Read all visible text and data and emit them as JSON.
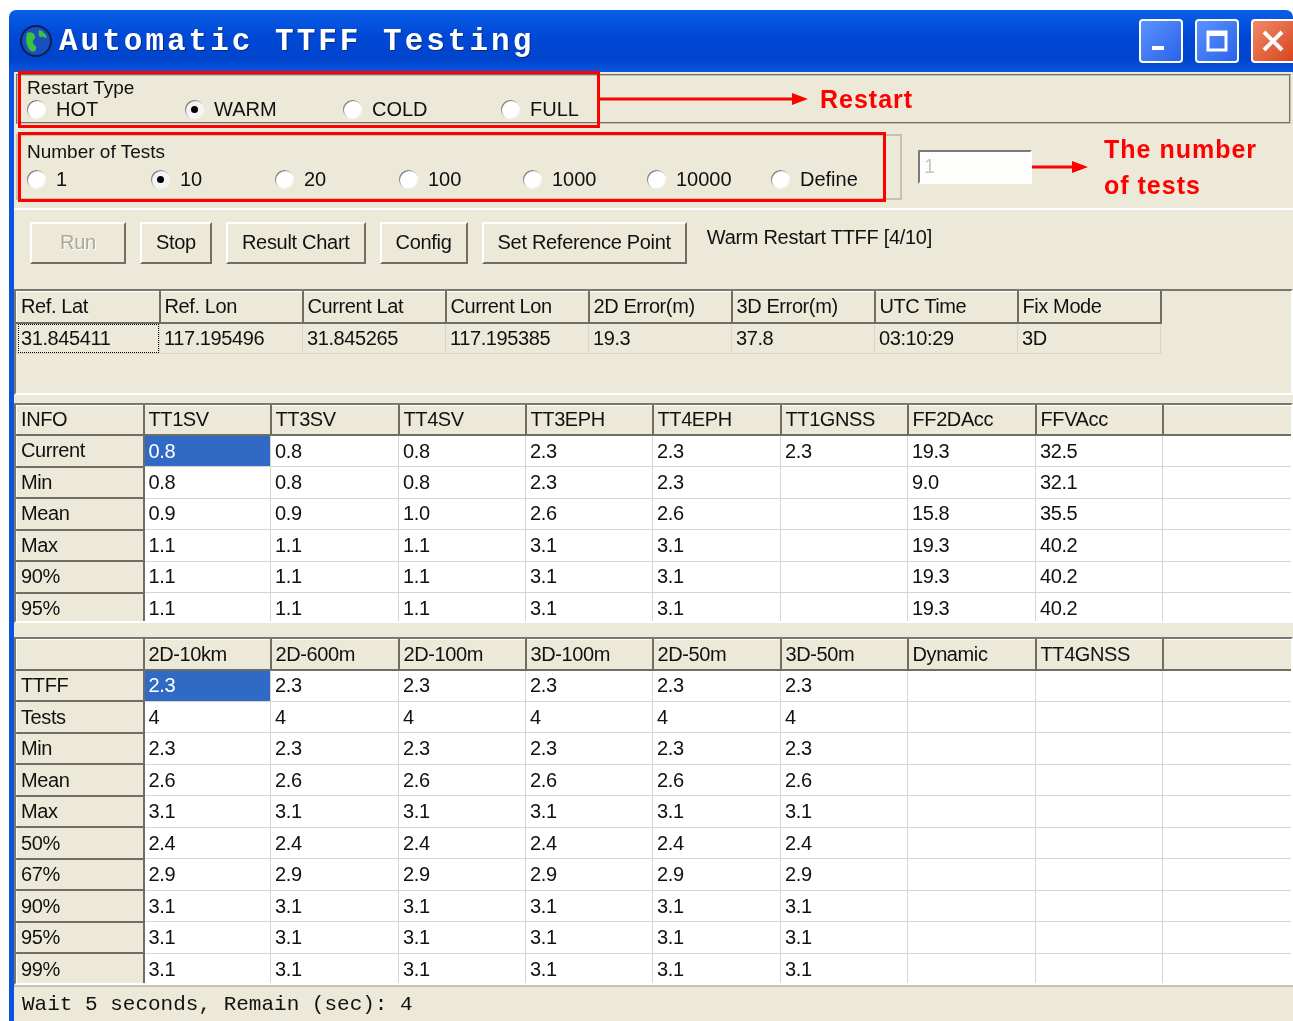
{
  "window": {
    "title": "Automatic TTFF Testing"
  },
  "restart_type": {
    "label": "Restart Type",
    "options": [
      {
        "label": "HOT",
        "selected": false
      },
      {
        "label": "WARM",
        "selected": true
      },
      {
        "label": "COLD",
        "selected": false
      },
      {
        "label": "FULL",
        "selected": false
      }
    ]
  },
  "number_of_tests": {
    "label": "Number of Tests",
    "options": [
      {
        "label": "1",
        "selected": false
      },
      {
        "label": "10",
        "selected": true
      },
      {
        "label": "20",
        "selected": false
      },
      {
        "label": "100",
        "selected": false
      },
      {
        "label": "1000",
        "selected": false
      },
      {
        "label": "10000",
        "selected": false
      },
      {
        "label": "Define",
        "selected": false
      }
    ],
    "define_field": {
      "value": "1",
      "disabled": true
    }
  },
  "annotations": [
    {
      "label": "Restart"
    },
    {
      "label": "The number of tests"
    }
  ],
  "buttons": [
    {
      "label": "Run",
      "disabled": true
    },
    {
      "label": "Stop",
      "disabled": false
    },
    {
      "label": "Result Chart",
      "disabled": false
    },
    {
      "label": "Config",
      "disabled": false
    },
    {
      "label": "Set Reference Point",
      "disabled": false
    }
  ],
  "progress_text": "Warm Restart TTFF [4/10]",
  "position_table": {
    "columns": [
      "Ref. Lat",
      "Ref. Lon",
      "Current Lat",
      "Current Lon",
      "2D Error(m)",
      "3D Error(m)",
      "UTC Time",
      "Fix Mode"
    ],
    "rows": [
      {
        "focused": true,
        "cells": [
          "31.845411",
          "117.195496",
          "31.845265",
          "117.195385",
          "19.3",
          "37.8",
          "03:10:29",
          "3D"
        ]
      }
    ]
  },
  "info_table": {
    "columns": [
      "INFO",
      "TT1SV",
      "TT3SV",
      "TT4SV",
      "TT3EPH",
      "TT4EPH",
      "TT1GNSS",
      "FF2DAcc",
      "FFVAcc"
    ],
    "rows": [
      {
        "selected": true,
        "cells": [
          "Current",
          "0.8",
          "0.8",
          "0.8",
          "2.3",
          "2.3",
          "2.3",
          "19.3",
          "32.5"
        ]
      },
      {
        "selected": false,
        "cells": [
          "Min",
          "0.8",
          "0.8",
          "0.8",
          "2.3",
          "2.3",
          "",
          "9.0",
          "32.1"
        ]
      },
      {
        "selected": false,
        "cells": [
          "Mean",
          "0.9",
          "0.9",
          "1.0",
          "2.6",
          "2.6",
          "",
          "15.8",
          "35.5"
        ]
      },
      {
        "selected": false,
        "cells": [
          "Max",
          "1.1",
          "1.1",
          "1.1",
          "3.1",
          "3.1",
          "",
          "19.3",
          "40.2"
        ]
      },
      {
        "selected": false,
        "cells": [
          "90%",
          "1.1",
          "1.1",
          "1.1",
          "3.1",
          "3.1",
          "",
          "19.3",
          "40.2"
        ]
      },
      {
        "selected": false,
        "cells": [
          "95%",
          "1.1",
          "1.1",
          "1.1",
          "3.1",
          "3.1",
          "",
          "19.3",
          "40.2"
        ]
      }
    ]
  },
  "accuracy_table": {
    "columns": [
      "",
      "2D-10km",
      "2D-600m",
      "2D-100m",
      "3D-100m",
      "2D-50m",
      "3D-50m",
      "Dynamic",
      "TT4GNSS"
    ],
    "rows": [
      {
        "selected": true,
        "cells": [
          "TTFF",
          "2.3",
          "2.3",
          "2.3",
          "2.3",
          "2.3",
          "2.3",
          "",
          ""
        ]
      },
      {
        "selected": false,
        "cells": [
          "Tests",
          "4",
          "4",
          "4",
          "4",
          "4",
          "4",
          "",
          ""
        ]
      },
      {
        "selected": false,
        "cells": [
          "Min",
          "2.3",
          "2.3",
          "2.3",
          "2.3",
          "2.3",
          "2.3",
          "",
          ""
        ]
      },
      {
        "selected": false,
        "cells": [
          "Mean",
          "2.6",
          "2.6",
          "2.6",
          "2.6",
          "2.6",
          "2.6",
          "",
          ""
        ]
      },
      {
        "selected": false,
        "cells": [
          "Max",
          "3.1",
          "3.1",
          "3.1",
          "3.1",
          "3.1",
          "3.1",
          "",
          ""
        ]
      },
      {
        "selected": false,
        "cells": [
          "50%",
          "2.4",
          "2.4",
          "2.4",
          "2.4",
          "2.4",
          "2.4",
          "",
          ""
        ]
      },
      {
        "selected": false,
        "cells": [
          "67%",
          "2.9",
          "2.9",
          "2.9",
          "2.9",
          "2.9",
          "2.9",
          "",
          ""
        ]
      },
      {
        "selected": false,
        "cells": [
          "90%",
          "3.1",
          "3.1",
          "3.1",
          "3.1",
          "3.1",
          "3.1",
          "",
          ""
        ]
      },
      {
        "selected": false,
        "cells": [
          "95%",
          "3.1",
          "3.1",
          "3.1",
          "3.1",
          "3.1",
          "3.1",
          "",
          ""
        ]
      },
      {
        "selected": false,
        "cells": [
          "99%",
          "3.1",
          "3.1",
          "3.1",
          "3.1",
          "3.1",
          "3.1",
          "",
          ""
        ]
      }
    ]
  },
  "status_bar": "Wait 5 seconds, Remain (sec): 4"
}
